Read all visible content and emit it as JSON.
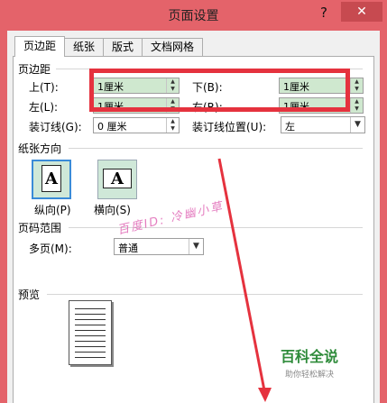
{
  "window": {
    "title": "页面设置",
    "help": "?",
    "close": "✕"
  },
  "tabs": [
    {
      "label": "页边距",
      "active": true
    },
    {
      "label": "纸张",
      "active": false
    },
    {
      "label": "版式",
      "active": false
    },
    {
      "label": "文档网格",
      "active": false
    }
  ],
  "margins": {
    "section_label": "页边距",
    "top_label": "上(T):",
    "top_value": "1厘米",
    "bottom_label": "下(B):",
    "bottom_value": "1厘米",
    "left_label": "左(L):",
    "left_value": "1厘米",
    "right_label": "右(R):",
    "right_value": "1厘米",
    "gutter_label": "装订线(G):",
    "gutter_value": "0 厘米",
    "gutter_pos_label": "装订线位置(U):",
    "gutter_pos_value": "左"
  },
  "orientation": {
    "section_label": "纸张方向",
    "portrait_label": "纵向(P)",
    "landscape_label": "横向(S)",
    "icon_glyph": "A"
  },
  "pages": {
    "section_label": "页码范围",
    "multi_label": "多页(M):",
    "multi_value": "普通"
  },
  "preview": {
    "section_label": "预览"
  },
  "overlay": {
    "watermark": "百度ID: 冷幽小草",
    "logo_main": "百科全说",
    "logo_sub": "助你轻松解决",
    "highlight_color": "#e5323e",
    "arrow_color": "#e5323e"
  }
}
